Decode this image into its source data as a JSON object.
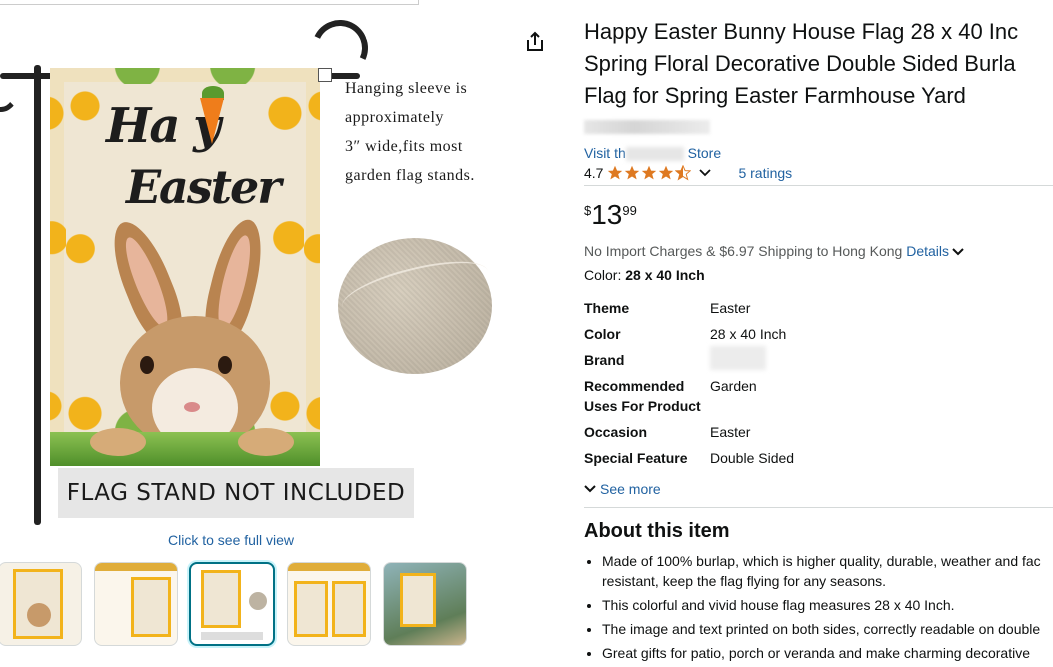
{
  "image_gallery": {
    "main_image": {
      "flag_text_line1": "Ha  y",
      "flag_text_line2": "Easter",
      "note_lines": [
        "Hanging sleeve is",
        "approximately",
        "3″ wide,fits most",
        "garden flag stands."
      ],
      "banner": "FLAG STAND NOT INCLUDED"
    },
    "full_view_link": "Click to see full view",
    "thumbnails": [
      {
        "label": "thumbnail-1",
        "selected": false
      },
      {
        "label": "thumbnail-2",
        "selected": false
      },
      {
        "label": "thumbnail-3",
        "selected": true
      },
      {
        "label": "thumbnail-4",
        "selected": false
      },
      {
        "label": "thumbnail-5",
        "selected": false
      }
    ]
  },
  "product": {
    "title_lines": [
      "Happy Easter Bunny House Flag 28 x 40 Inc",
      "Spring Floral Decorative Double Sided Burla",
      "Flag for Spring Easter Farmhouse Yard"
    ],
    "visit_store_prefix": "Visit th",
    "visit_store_suffix": "Store",
    "rating_value": "4.7",
    "stars_filled": 4.5,
    "ratings_count": "5 ratings",
    "price": {
      "symbol": "$",
      "whole": "13",
      "fraction": "99"
    },
    "shipping_text": "No Import Charges & $6.97 Shipping to Hong Kong",
    "shipping_details_link": "Details",
    "color_label": "Color:",
    "color_value": "28 x 40 Inch",
    "specs": [
      {
        "key": "Theme",
        "value": "Easter"
      },
      {
        "key": "Color",
        "value": "28 x 40 Inch"
      },
      {
        "key": "Brand",
        "value": ""
      },
      {
        "key": "Recommended Uses For Product",
        "value": "Garden"
      },
      {
        "key": "Occasion",
        "value": "Easter"
      },
      {
        "key": "Special Feature",
        "value": "Double Sided"
      }
    ],
    "see_more": "See more",
    "about_title": "About this item",
    "bullets": [
      "Made of 100% burlap, which is higher quality, durable, weather and fac",
      "resistant, keep the flag flying for any seasons.",
      "This colorful and vivid house flag measures 28 x 40 Inch.",
      "The image and text printed on both sides, correctly readable on double",
      "Great gifts for patio, porch or veranda and make charming decorative"
    ]
  },
  "colors": {
    "link": "#2162a1",
    "star": "#de7921",
    "text": "#0f1111",
    "muted": "#565959",
    "selected_thumb": "#007185"
  },
  "icons": {
    "share": "share-icon",
    "star": "star-icon",
    "chevron": "chevron-down-icon"
  }
}
